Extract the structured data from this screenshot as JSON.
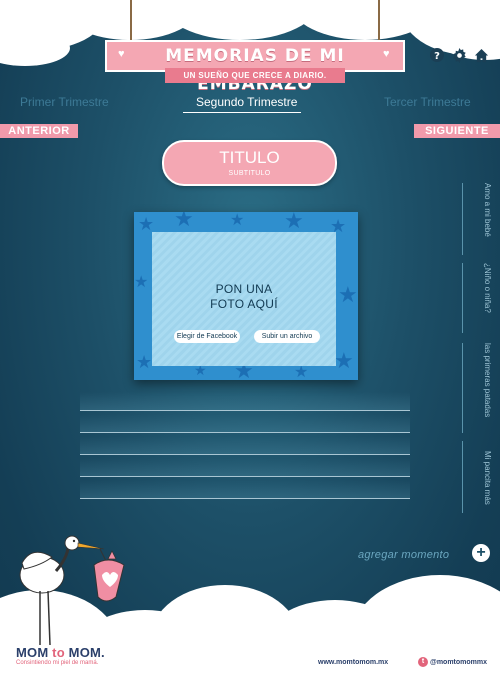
{
  "header": {
    "title": "MEMORIAS DE MI EMBARAZO",
    "subtitle": "UN SUEÑO QUE CRECE A DIARIO."
  },
  "icons": [
    "help-icon",
    "gear-icon",
    "home-icon"
  ],
  "trimesters": {
    "first": "Primer Trimestre",
    "second": "Segundo Trimestre",
    "third": "Tercer Trimestre"
  },
  "nav": {
    "prev": "ANTERIOR",
    "next": "SIGUIENTE"
  },
  "badge": {
    "title": "TITULO",
    "subtitle": "SUBTITULO"
  },
  "photo": {
    "placeholder": "PON UNA\nFOTO AQUÍ",
    "facebook_button": "Elegir de Facebook",
    "upload_button": "Subir un archivo"
  },
  "side_tabs": [
    "Amo a mi bebé",
    "¿Niño o niña?",
    "las primeras patadas",
    "Mi pancita más"
  ],
  "add_moment": "agregar momento",
  "footer": {
    "brand_a": "MOM",
    "brand_b": " to ",
    "brand_c": "MOM.",
    "tagline": "Consintiendo mi piel de mamá.",
    "url": "www.momtomom.mx",
    "twitter": "@momtomommx"
  },
  "colors": {
    "background": "#1d5068",
    "pink": "#f4a7b3",
    "frame_blue": "#2f8fce"
  }
}
